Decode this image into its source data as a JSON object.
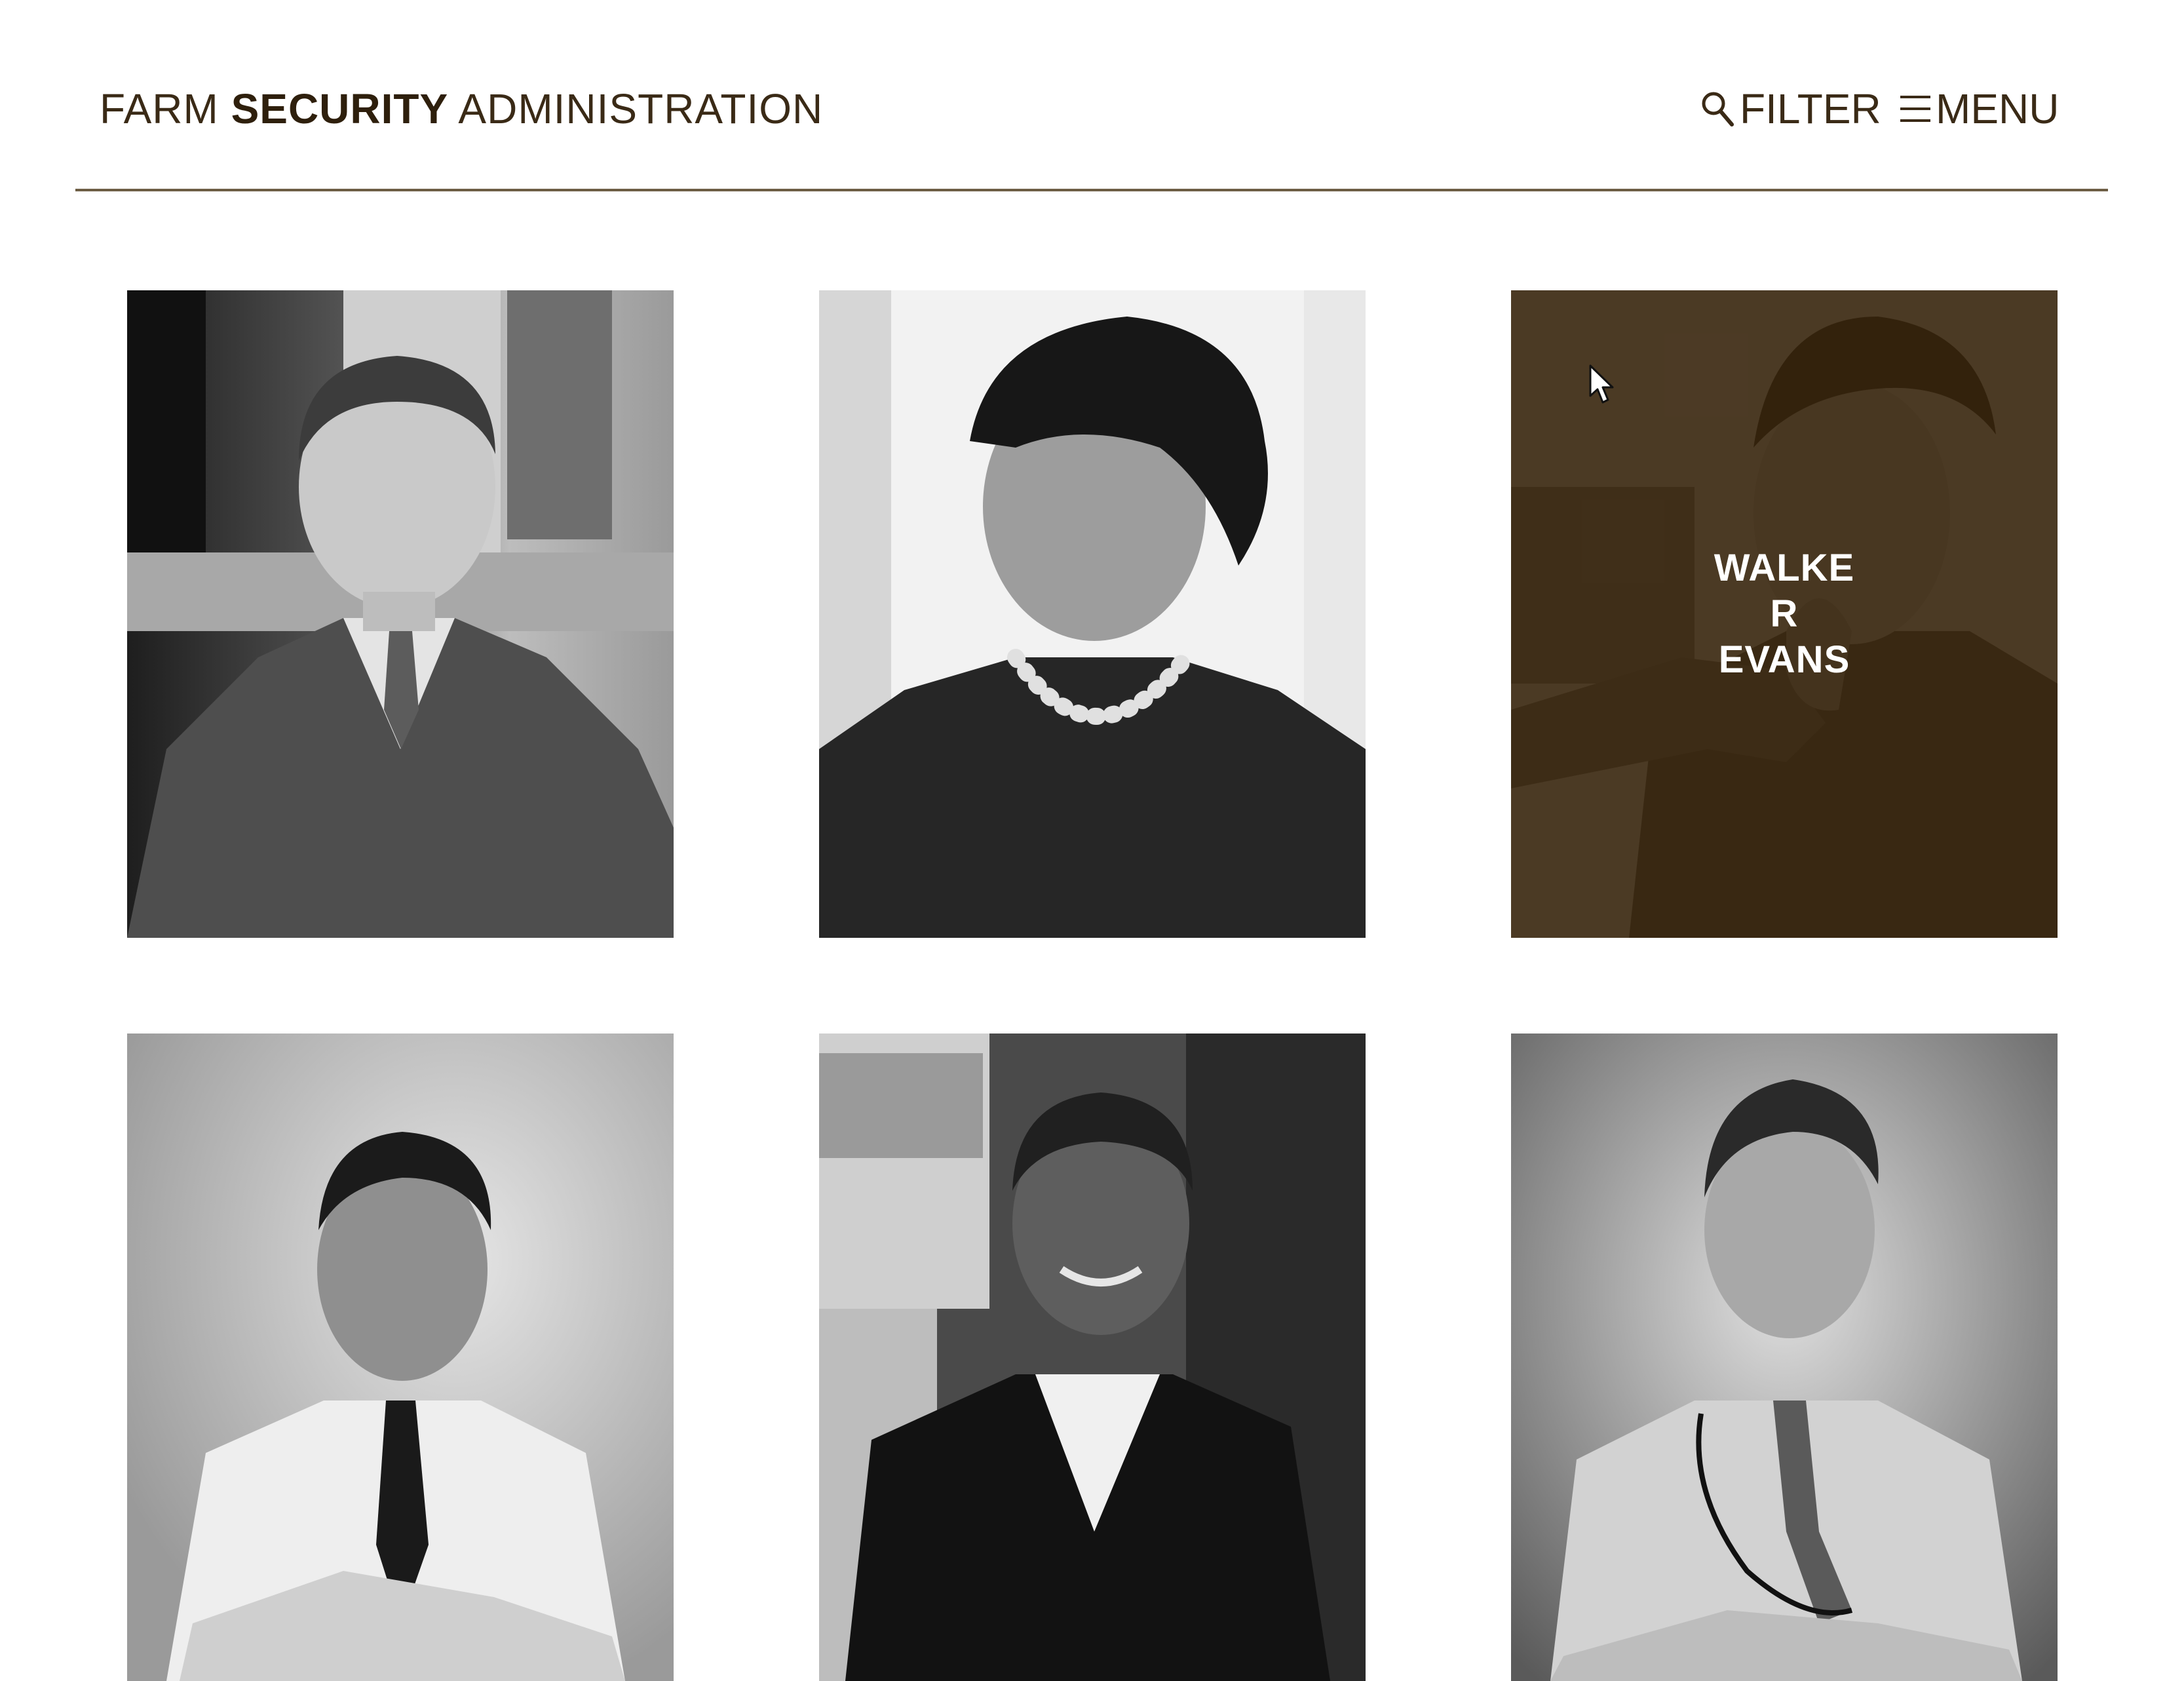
{
  "header": {
    "logo_part1": "FARM ",
    "logo_part2": "SECURITY",
    "logo_part3": " ADMINISTRATION",
    "filter_label": "FILTER",
    "menu_label": "MENU"
  },
  "colors": {
    "brand_text": "#3a2a16",
    "divider": "#6d5e45",
    "hover_overlay": "#3a2408"
  },
  "icons": {
    "filter": "search-icon",
    "menu": "hamburger-icon"
  },
  "grid": {
    "photographers": [
      {
        "photo": "portrait-man-in-herringbone-suit"
      },
      {
        "photo": "portrait-woman-in-beret-with-pearls"
      },
      {
        "photo": "portrait-man-hand-on-chin",
        "hover_name": "WALKER EVANS"
      },
      {
        "photo": "portrait-young-man-in-tie"
      },
      {
        "photo": "portrait-smiling-man-in-blazer"
      },
      {
        "photo": "portrait-man-with-camera-strap"
      }
    ]
  }
}
